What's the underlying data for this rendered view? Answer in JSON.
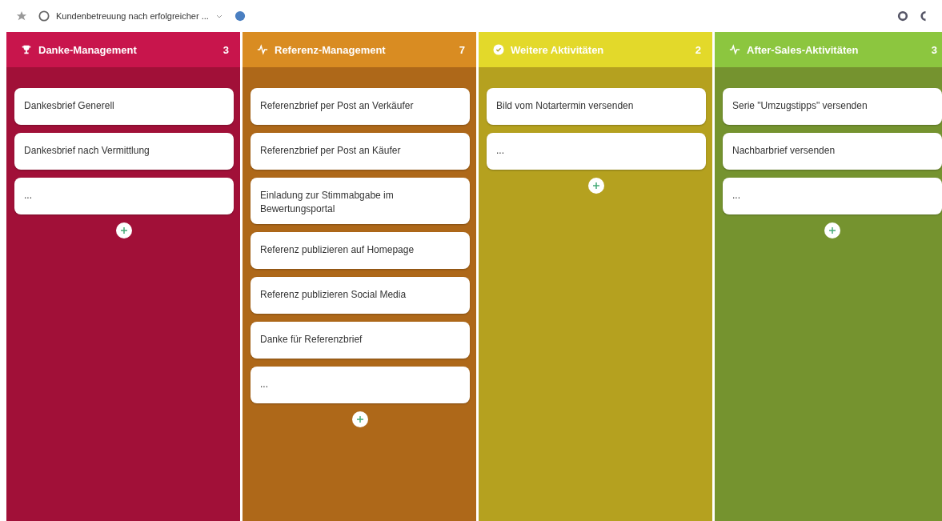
{
  "browser_tab": {
    "title": "Kundenbetreuung nach erfolgreicher ..."
  },
  "columns": [
    {
      "title": "Danke-Management",
      "count": "3",
      "color": "#c8154c",
      "cards": [
        "Dankesbrief Generell",
        "Dankesbrief nach Vermittlung",
        "..."
      ]
    },
    {
      "title": "Referenz-Management",
      "count": "7",
      "color": "#d98c22",
      "cards": [
        "Referenzbrief per Post an Verkäufer",
        "Referenzbrief per Post an Käufer",
        "Einladung zur Stimmabgabe im Bewertungsportal",
        "Referenz publizieren auf Homepage",
        "Referenz publizieren Social Media",
        "Danke für Referenzbrief",
        "..."
      ]
    },
    {
      "title": "Weitere Aktivitäten",
      "count": "2",
      "color": "#e3d92a",
      "cards": [
        "Bild vom Notartermin versenden",
        "..."
      ]
    },
    {
      "title": "After-Sales-Aktivitäten",
      "count": "3",
      "color": "#8cc63f",
      "cards": [
        "Serie \"Umzugstipps\" versenden",
        "Nachbarbrief versenden",
        "..."
      ]
    }
  ]
}
